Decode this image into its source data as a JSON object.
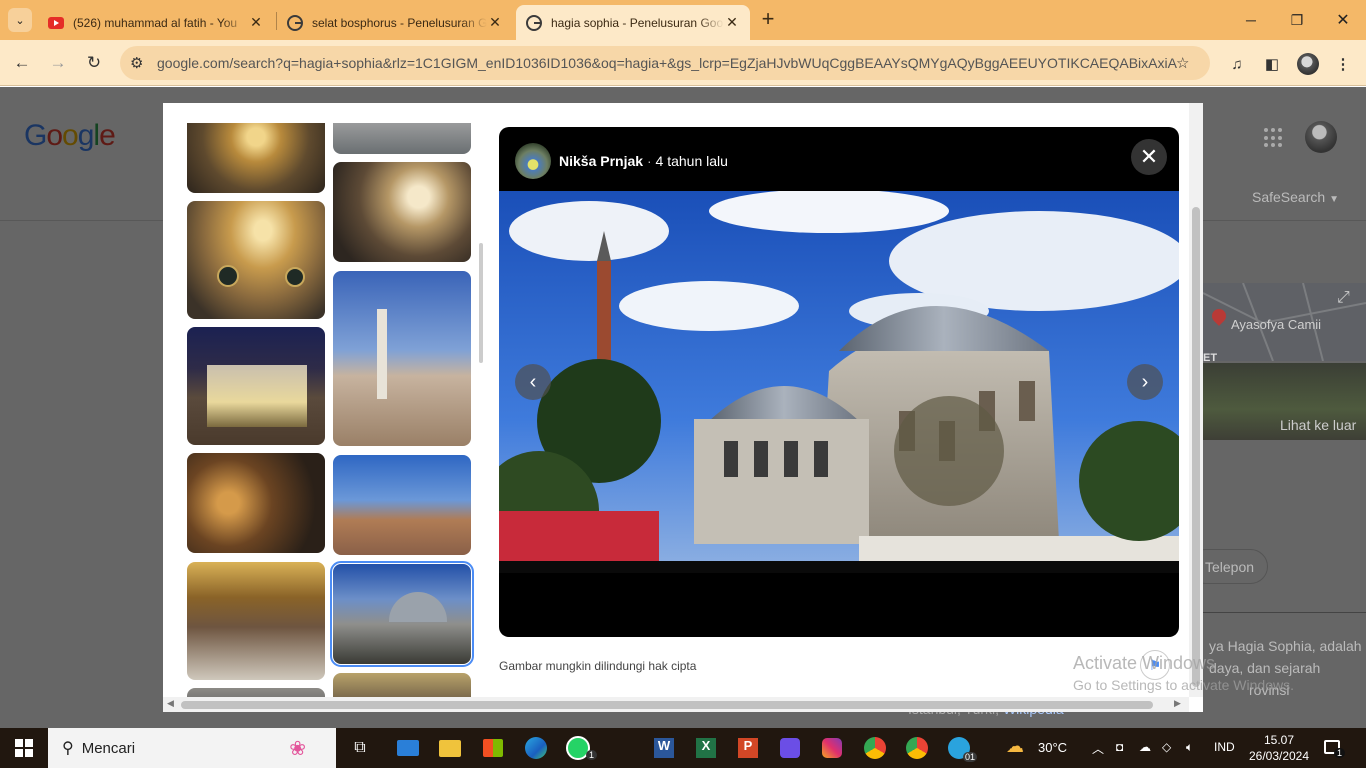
{
  "browser": {
    "tabs": [
      {
        "title": "(526) muhammad al fatih - You",
        "icon": "youtube-icon"
      },
      {
        "title": "selat bosphorus - Penelusuran G",
        "icon": "google-icon"
      },
      {
        "title": "hagia sophia - Penelusuran Goo",
        "icon": "google-icon",
        "active": true
      }
    ],
    "address": "google.com/search?q=hagia+sophia&rlz=1C1GIGM_enID1036ID1036&oq=hagia+&gs_lcrp=EgZjaHJvbWUqCggBEAAYsQMYgAQyBggAEEUYOTIKCAEQABixAxiAB..."
  },
  "page": {
    "logo": "Google",
    "safesearch": "SafeSearch",
    "map_label": "Ayasofya Camii",
    "map_corner": "ET",
    "lihat": "Lihat ke luar",
    "telepon": "Telepon",
    "desc_line1": "ya Hagia Sophia, adalah",
    "desc_line2": "daya, dan sejarah",
    "desc_line3": "rovinsi",
    "desc_line4": "Istanbul, Turki",
    "desc_link": "Wikipedia"
  },
  "viewer": {
    "author": "Nikša Prnjak",
    "time": "4 tahun lalu",
    "copyright": "Gambar mungkin dilindungi hak cipta"
  },
  "watermark": {
    "title": "Activate Windows",
    "sub": "Go to Settings to activate Windows."
  },
  "taskbar": {
    "search": "Mencari",
    "weather": "30°C",
    "lang": "IND",
    "time": "15.07",
    "date": "26/03/2024",
    "whatsapp_badge": "1",
    "telegram_badge": "01",
    "notif_badge": "1"
  },
  "colors": {
    "tabbar": "#f4b868",
    "toolbar": "#fde9c8",
    "taskbar": "#21170f",
    "selection": "#4b8cf5"
  }
}
